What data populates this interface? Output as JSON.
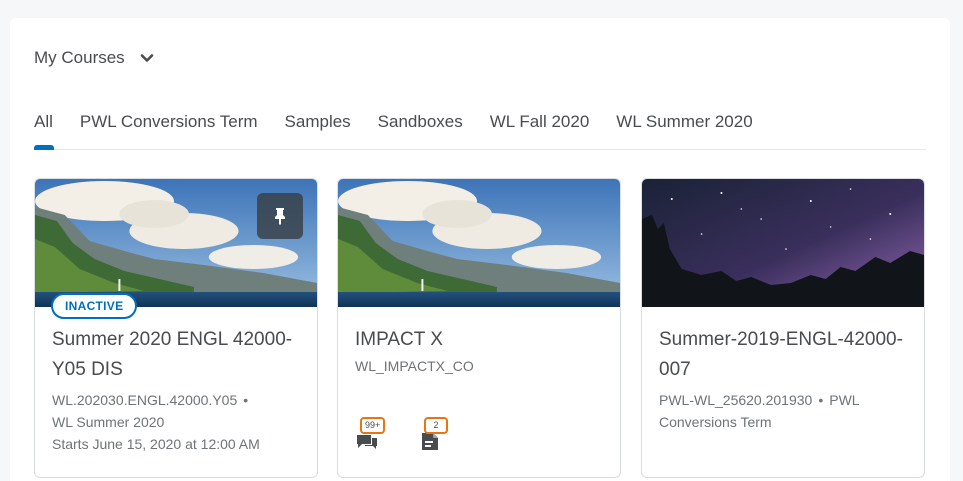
{
  "widget": {
    "title": "My Courses",
    "tabs": [
      {
        "label": "All",
        "selected": true
      },
      {
        "label": "PWL Conversions Term"
      },
      {
        "label": "Samples"
      },
      {
        "label": "Sandboxes"
      },
      {
        "label": "WL Fall 2020"
      },
      {
        "label": "WL Summer 2020"
      }
    ]
  },
  "courses": [
    {
      "badge": "INACTIVE",
      "pinned": true,
      "title": "Summer 2020 ENGL 42000-Y05 DIS",
      "code": "WL.202030.ENGL.42000.Y05",
      "separator": "•",
      "semester": "WL Summer 2020",
      "start": "Starts June 15, 2020 at 12:00 AM"
    },
    {
      "title": "IMPACT X",
      "code": "WL_IMPACTX_CO",
      "notifications": {
        "discussions": "99+",
        "assignments": "2"
      }
    },
    {
      "title": "Summer-2019-ENGL-42000-007",
      "code": "PWL-WL_25620.201930",
      "separator": "•",
      "semester": "PWL Conversions Term"
    }
  ],
  "colors": {
    "accent": "#006fbf",
    "notification": "#e87511",
    "text": "#494c4e"
  },
  "icons": {
    "header_toggle": "chevron-down-icon",
    "pin": "pin-icon",
    "discussions": "discussions-icon",
    "assignments": "assignments-icon"
  }
}
